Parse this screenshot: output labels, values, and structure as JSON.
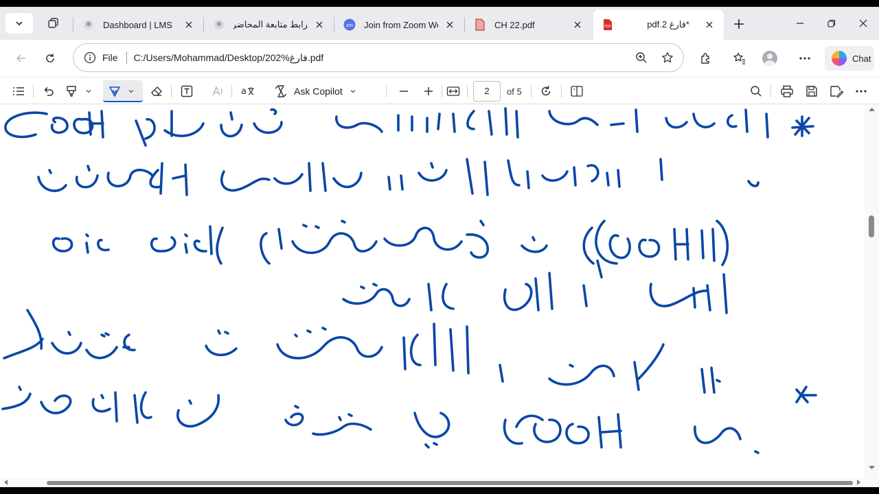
{
  "browser": {
    "tabs": [
      {
        "title": "Dashboard | LMS",
        "favicon": "lms-icon",
        "active": false
      },
      {
        "title": "رابط متابعة المحاضرات",
        "favicon": "lms-icon",
        "active": false
      },
      {
        "title": "Join from Zoom Web",
        "favicon": "zoom-icon",
        "active": false
      },
      {
        "title": "CH 22.pdf",
        "favicon": "pdf-icon",
        "active": false
      },
      {
        "title": "*فارغ pdf.2",
        "favicon": "pdf-icon",
        "active": true
      }
    ],
    "address": {
      "scheme_label": "File",
      "url": "C:/Users/Mohammad/Desktop/202%فارغ.pdf"
    },
    "chat_label": "Chat"
  },
  "pdf_toolbar": {
    "ask_copilot_label": "Ask Copilot",
    "page_current": "2",
    "page_total_label": "of 5",
    "active_tool": "draw"
  },
  "document": {
    "content": "handwritten-arabic-chemistry-notes",
    "ink_color": "#0a47a6",
    "visible_latin_ink": [
      "COOH",
      "oic acid",
      "(COOH)",
      "COOH"
    ]
  },
  "colors": {
    "accent": "#0b57d0",
    "tab_strip": "#e9ebee",
    "pdf_icon": "#d93025"
  }
}
